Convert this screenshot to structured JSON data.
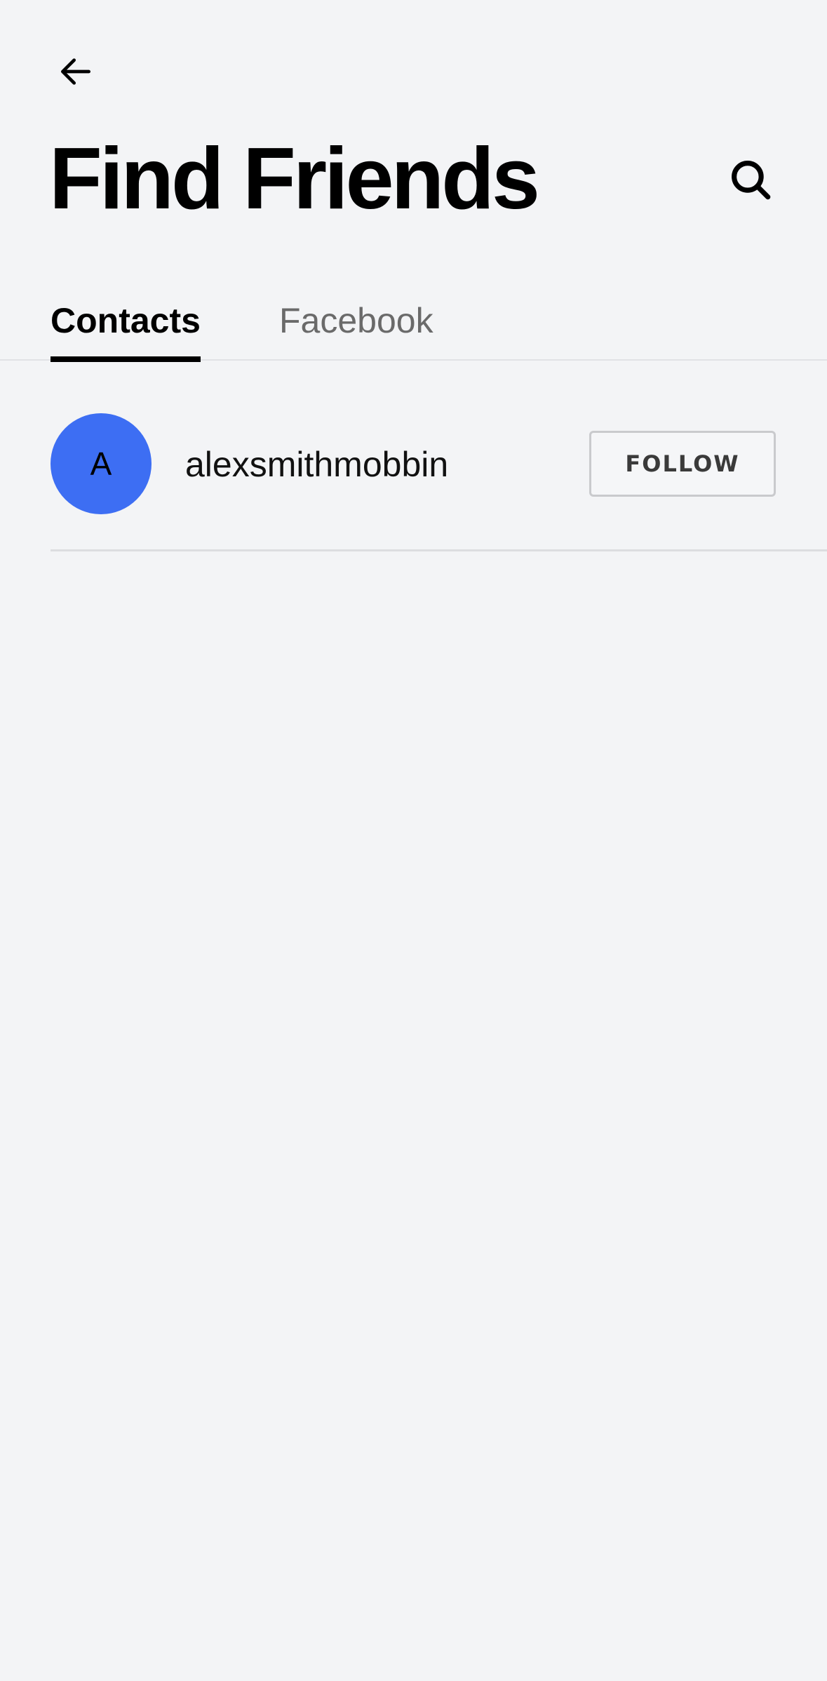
{
  "header": {
    "back_icon": "arrow-left-icon",
    "title": "Find Friends",
    "search_icon": "search-icon"
  },
  "tabs": [
    {
      "label": "Contacts",
      "active": true
    },
    {
      "label": "Facebook",
      "active": false
    }
  ],
  "contacts": [
    {
      "avatar_initial": "A",
      "avatar_color": "#3d6ef3",
      "username": "alexsmithmobbin",
      "follow_label": "FOLLOW"
    }
  ],
  "colors": {
    "background": "#f3f4f6",
    "accent": "#3d6ef3",
    "tab_inactive": "#6a6a6a",
    "divider": "#dcdde0"
  }
}
